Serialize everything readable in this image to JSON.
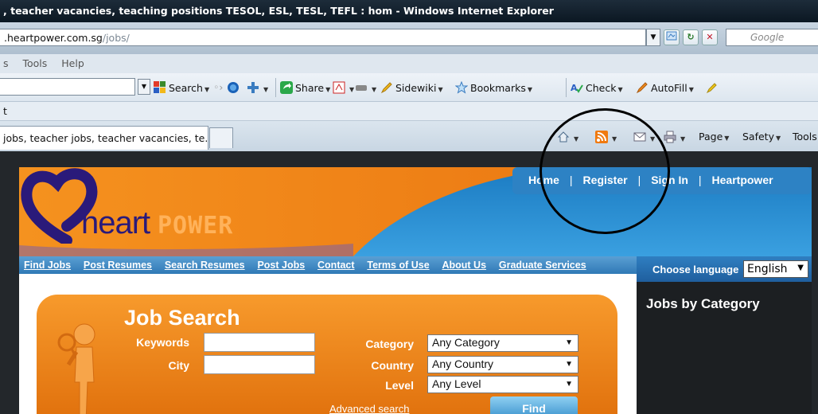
{
  "window": {
    "title": ", teacher vacancies, teaching positions TESOL, ESL, TESL, TEFL : hom - Windows Internet Explorer",
    "address_main": ".heartpower.com.sg",
    "address_path": "/jobs/",
    "search_engine": "Google"
  },
  "menu": [
    "s",
    "Tools",
    "Help"
  ],
  "toolbar": {
    "search_label": "Search",
    "share_label": "Share",
    "sidewiki_label": "Sidewiki",
    "bookmarks_label": "Bookmarks",
    "check_label": "Check",
    "autofill_label": "AutoFill"
  },
  "links_bar_text": "t",
  "tab": {
    "title": "jobs, teacher jobs, teacher vacancies, te...",
    "page_label": "Page",
    "safety_label": "Safety",
    "tools_label": "Tools"
  },
  "site": {
    "logo_word": "heart",
    "logo_power": "POWER",
    "top_links": [
      "Home",
      "Register",
      "Sign In",
      "Heartpower"
    ],
    "nav": [
      "Find Jobs",
      "Post Resumes",
      "Search Resumes",
      "Post Jobs",
      "Contact",
      "Terms of Use",
      "About Us",
      "Graduate Services"
    ],
    "language_label": "Choose language",
    "language_value": "English",
    "sidebar_heading": "Jobs by Category",
    "job_search": {
      "title": "Job Search",
      "keywords_label": "Keywords",
      "city_label": "City",
      "category_label": "Category",
      "category_value": "Any Category",
      "country_label": "Country",
      "country_value": "Any Country",
      "level_label": "Level",
      "level_value": "Any Level",
      "advanced_link": "Advanced search",
      "find_button": "Find"
    }
  },
  "colors": {
    "orange": "#f08a1c",
    "blue": "#2f79b6",
    "logo_purple": "#2a1a7a"
  }
}
